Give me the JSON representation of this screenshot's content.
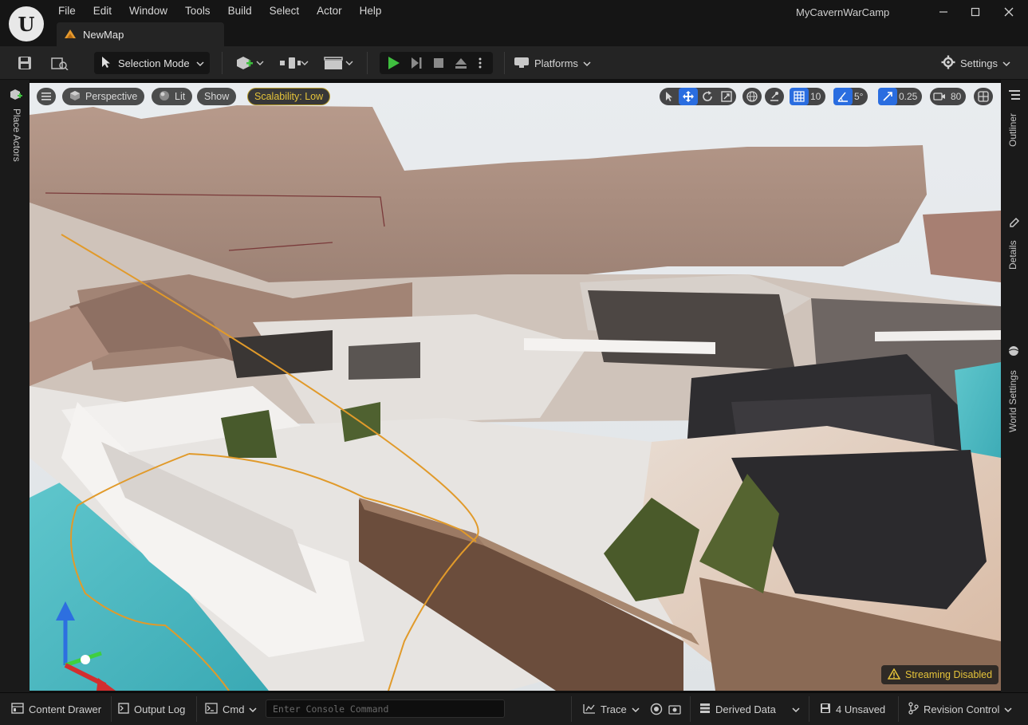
{
  "window": {
    "title": "MyCavernWarCamp",
    "controls": [
      "minimize-icon",
      "maximize-icon",
      "close-icon"
    ]
  },
  "menu": [
    "File",
    "Edit",
    "Window",
    "Tools",
    "Build",
    "Select",
    "Actor",
    "Help"
  ],
  "tab": {
    "label": "NewMap",
    "icon": "level-icon"
  },
  "toolbar": {
    "selection_mode": "Selection Mode",
    "platforms": "Platforms",
    "settings": "Settings",
    "play_color": "#3fbf3f"
  },
  "side_tabs": {
    "left": "Place Actors",
    "right": [
      "Outliner",
      "Details",
      "World Settings"
    ]
  },
  "viewport": {
    "view_mode": "Perspective",
    "lighting": "Lit",
    "show": "Show",
    "scalability": "Scalability: Low",
    "grid_snap": "10",
    "rotation_snap": "5°",
    "scale_snap": "0.25",
    "camera_speed": "80",
    "streaming_warning": "Streaming Disabled",
    "active_tool_color": "#2a6de0",
    "warning_color": "#e5c33a"
  },
  "statusbar": {
    "content_drawer": "Content Drawer",
    "output_log": "Output Log",
    "cmd": "Cmd",
    "console_placeholder": "Enter Console Command",
    "trace": "Trace",
    "derived_data": "Derived Data",
    "unsaved": "4 Unsaved",
    "revision_control": "Revision Control"
  }
}
